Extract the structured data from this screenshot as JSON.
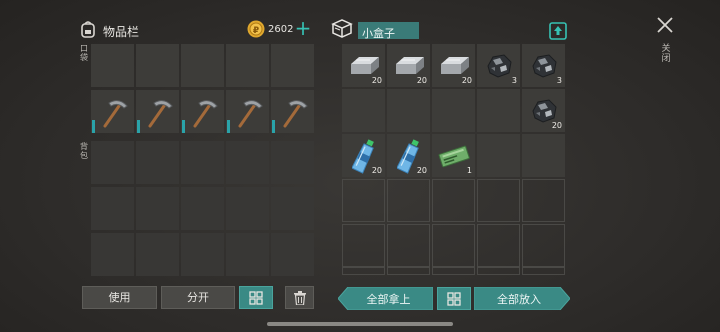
{
  "inventory": {
    "title": "物品栏",
    "coins": "2602",
    "side_label_pocket": "口袋",
    "side_label_backpack": "背包",
    "pocket_row1": [
      {},
      {},
      {},
      {},
      {}
    ],
    "pocket_row2": [
      {
        "item": "pickaxe-icon"
      },
      {
        "item": "pickaxe-icon"
      },
      {
        "item": "pickaxe-icon"
      },
      {
        "item": "pickaxe-icon"
      },
      {
        "item": "pickaxe-icon"
      }
    ]
  },
  "storage": {
    "title": "小盒子",
    "close_label": "关闭",
    "slots": [
      {
        "item": "iron-ingot-icon",
        "count": "20"
      },
      {
        "item": "iron-ingot-icon",
        "count": "20"
      },
      {
        "item": "iron-ingot-icon",
        "count": "20"
      },
      {
        "item": "ore-icon",
        "count": "3"
      },
      {
        "item": "ore-icon",
        "count": "3"
      },
      {},
      {},
      {},
      {},
      {
        "item": "ore-icon",
        "count": "20"
      },
      {
        "item": "water-bottle-icon",
        "count": "20"
      },
      {
        "item": "water-bottle-icon",
        "count": "20"
      },
      {
        "item": "ticket-icon",
        "count": "1"
      },
      {},
      {}
    ]
  },
  "buttons": {
    "use": "使用",
    "split": "分开",
    "take_all": "全部拿上",
    "put_all": "全部放入"
  },
  "colors": {
    "accent": "#3a8a85",
    "slot": "#3d3c39",
    "coin": "#e0a82e"
  }
}
